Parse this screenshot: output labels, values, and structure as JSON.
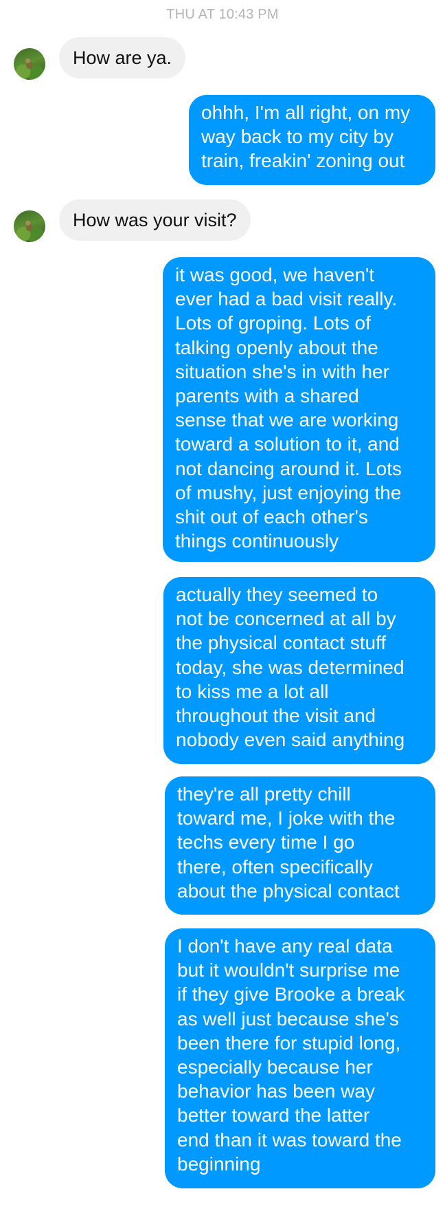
{
  "timestamp": "THU AT 10:43 PM",
  "messages": [
    {
      "from": "them",
      "text": "How are ya."
    },
    {
      "from": "me",
      "text": "ohhh, I'm all right, on my\nway back to my city by\ntrain, freakin' zoning out"
    },
    {
      "from": "them",
      "text": "How was your visit?"
    },
    {
      "from": "me",
      "text": "it was good, we haven't\never had a bad visit really.\nLots of groping. Lots of\ntalking openly about the\nsituation she's in with her\nparents with a shared\nsense that we are working\ntoward a solution to it, and\nnot dancing around it. Lots\nof mushy, just enjoying the\nshit out of each other's\nthings continuously"
    },
    {
      "from": "me",
      "text": "actually they seemed to\nnot be concerned at all by\nthe physical contact stuff\ntoday, she was determined\nto kiss me a lot all\nthroughout the visit and\nnobody even said anything"
    },
    {
      "from": "me",
      "text": "they're all pretty chill\ntoward me, I joke with the\ntechs every time I go\nthere, often specifically\nabout the physical contact"
    },
    {
      "from": "me",
      "text": "I don't have any real data\nbut it wouldn't surprise me\nif they give Brooke a break\nas well just because she's\nbeen there for stupid long,\nespecially because her\nbehavior has been way\nbetter toward the latter\nend than it was toward the\nbeginning"
    }
  ]
}
